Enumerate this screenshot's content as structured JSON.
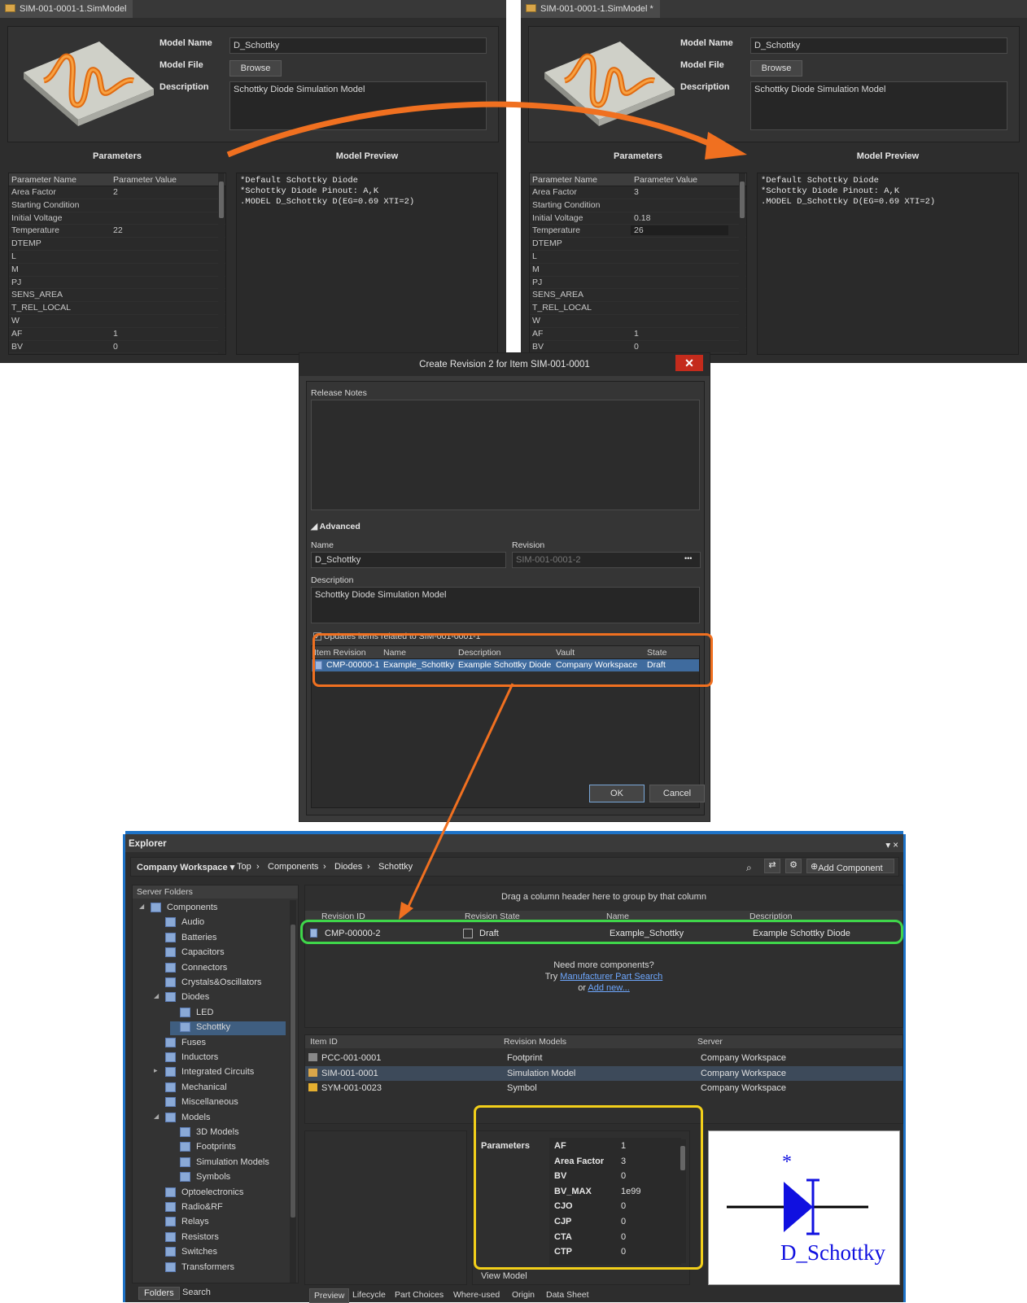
{
  "left_panel": {
    "tab_title": "SIM-001-0001-1.SimModel",
    "model_name_label": "Model Name",
    "model_name_value": "D_Schottky",
    "model_file_label": "Model File",
    "browse_label": "Browse",
    "description_label": "Description",
    "description_value": "Schottky Diode Simulation Model",
    "parameters_header": "Parameters",
    "preview_header": "Model Preview",
    "col_name": "Parameter Name",
    "col_value": "Parameter Value",
    "rows": [
      [
        "Area Factor",
        "2"
      ],
      [
        "Starting Condition",
        ""
      ],
      [
        "Initial Voltage",
        ""
      ],
      [
        "Temperature",
        "22"
      ],
      [
        "DTEMP",
        ""
      ],
      [
        "L",
        ""
      ],
      [
        "M",
        ""
      ],
      [
        "PJ",
        ""
      ],
      [
        "SENS_AREA",
        ""
      ],
      [
        "T_REL_LOCAL",
        ""
      ],
      [
        "W",
        ""
      ],
      [
        "AF",
        "1"
      ],
      [
        "BV",
        "0"
      ]
    ],
    "preview_text": "*Default Schottky Diode\n*Schottky Diode Pinout: A,K\n.MODEL D_Schottky D(EG=0.69 XTI=2)"
  },
  "right_panel": {
    "tab_title": "SIM-001-0001-1.SimModel *",
    "model_name_label": "Model Name",
    "model_name_value": "D_Schottky",
    "model_file_label": "Model File",
    "browse_label": "Browse",
    "description_label": "Description",
    "description_value": "Schottky Diode Simulation Model",
    "parameters_header": "Parameters",
    "preview_header": "Model Preview",
    "col_name": "Parameter Name",
    "col_value": "Parameter Value",
    "rows": [
      [
        "Area Factor",
        "3"
      ],
      [
        "Starting Condition",
        ""
      ],
      [
        "Initial Voltage",
        "0.18"
      ],
      [
        "Temperature",
        "26"
      ],
      [
        "DTEMP",
        ""
      ],
      [
        "L",
        ""
      ],
      [
        "M",
        ""
      ],
      [
        "PJ",
        ""
      ],
      [
        "SENS_AREA",
        ""
      ],
      [
        "T_REL_LOCAL",
        ""
      ],
      [
        "W",
        ""
      ],
      [
        "AF",
        "1"
      ],
      [
        "BV",
        "0"
      ]
    ],
    "preview_text": "*Default Schottky Diode\n*Schottky Diode Pinout: A,K\n.MODEL D_Schottky D(EG=0.69 XTI=2)"
  },
  "dialog": {
    "title": "Create Revision 2 for Item SIM-001-0001",
    "close": "✕",
    "release_notes_label": "Release Notes",
    "advanced_label": "Advanced",
    "name_label": "Name",
    "name_value": "D_Schottky",
    "revision_label": "Revision",
    "revision_value": "SIM-001-0001-2",
    "revision_more": "•••",
    "description_label": "Description",
    "description_value": "Schottky Diode Simulation Model",
    "updates_label": "Updates items related to SIM-001-0001-1",
    "columns": [
      "Item Revision",
      "Name",
      "Description",
      "Vault",
      "State"
    ],
    "row": [
      "CMP-00000-1",
      "Example_Schottky",
      "Example Schottky Diode",
      "Company Workspace",
      "Draft"
    ],
    "ok": "OK",
    "cancel": "Cancel"
  },
  "explorer": {
    "title": "Explorer",
    "window_controls": "▾ ×",
    "workspace": "Company Workspace ▾",
    "crumbs": [
      "Top",
      "Components",
      "Diodes",
      "Schottky"
    ],
    "add_component": "Add Component",
    "server_folders": "Server Folders",
    "tree": [
      {
        "label": "Components",
        "level": 0
      },
      {
        "label": "Audio",
        "level": 1
      },
      {
        "label": "Batteries",
        "level": 1
      },
      {
        "label": "Capacitors",
        "level": 1
      },
      {
        "label": "Connectors",
        "level": 1
      },
      {
        "label": "Crystals&Oscillators",
        "level": 1
      },
      {
        "label": "Diodes",
        "level": 1
      },
      {
        "label": "LED",
        "level": 2
      },
      {
        "label": "Schottky",
        "level": 2
      },
      {
        "label": "Fuses",
        "level": 1
      },
      {
        "label": "Inductors",
        "level": 1
      },
      {
        "label": "Integrated Circuits",
        "level": 1
      },
      {
        "label": "Mechanical",
        "level": 1
      },
      {
        "label": "Miscellaneous",
        "level": 1
      },
      {
        "label": "Models",
        "level": 1
      },
      {
        "label": "3D Models",
        "level": 2
      },
      {
        "label": "Footprints",
        "level": 2
      },
      {
        "label": "Simulation Models",
        "level": 2
      },
      {
        "label": "Symbols",
        "level": 2
      },
      {
        "label": "Optoelectronics",
        "level": 1
      },
      {
        "label": "Radio&RF",
        "level": 1
      },
      {
        "label": "Relays",
        "level": 1
      },
      {
        "label": "Resistors",
        "level": 1
      },
      {
        "label": "Switches",
        "level": 1
      },
      {
        "label": "Transformers",
        "level": 1
      }
    ],
    "folders_tab": "Folders",
    "search_tab": "Search",
    "group_hint": "Drag a column header here to group by that column",
    "rev_columns": [
      "Revision ID",
      "Revision State",
      "Name",
      "Description"
    ],
    "rev_row": [
      "CMP-00000-2",
      "Draft",
      "Example_Schottky",
      "Example Schottky Diode"
    ],
    "need_more": "Need more components?",
    "try_text": "Try",
    "mps_link": "Manufacturer Part Search",
    "or_text": "or",
    "add_new": "Add new...",
    "model_columns": [
      "Item ID",
      "Revision Models",
      "Server"
    ],
    "model_rows": [
      [
        "PCC-001-0001",
        "Footprint",
        "Company Workspace"
      ],
      [
        "SIM-001-0001",
        "Simulation Model",
        "Company Workspace"
      ],
      [
        "SYM-001-0023",
        "Symbol",
        "Company Workspace"
      ]
    ],
    "params_label": "Parameters",
    "params": [
      [
        "AF",
        "1"
      ],
      [
        "Area Factor",
        "3"
      ],
      [
        "BV",
        "0"
      ],
      [
        "BV_MAX",
        "1e99"
      ],
      [
        "CJO",
        "0"
      ],
      [
        "CJP",
        "0"
      ],
      [
        "CTA",
        "0"
      ],
      [
        "CTP",
        "0"
      ]
    ],
    "view_model": "View Model",
    "symbol_label": "D_Schottky",
    "symbol_star": "*",
    "bottom_tabs": [
      "Preview",
      "Lifecycle",
      "Part Choices",
      "Where-used",
      "Origin",
      "Data Sheet"
    ]
  },
  "colors": {
    "orange": "#f07020",
    "green": "#3fd64a",
    "yellow": "#f2cf1a",
    "selection": "#3f6b9e",
    "accent": "#1e73c8"
  }
}
